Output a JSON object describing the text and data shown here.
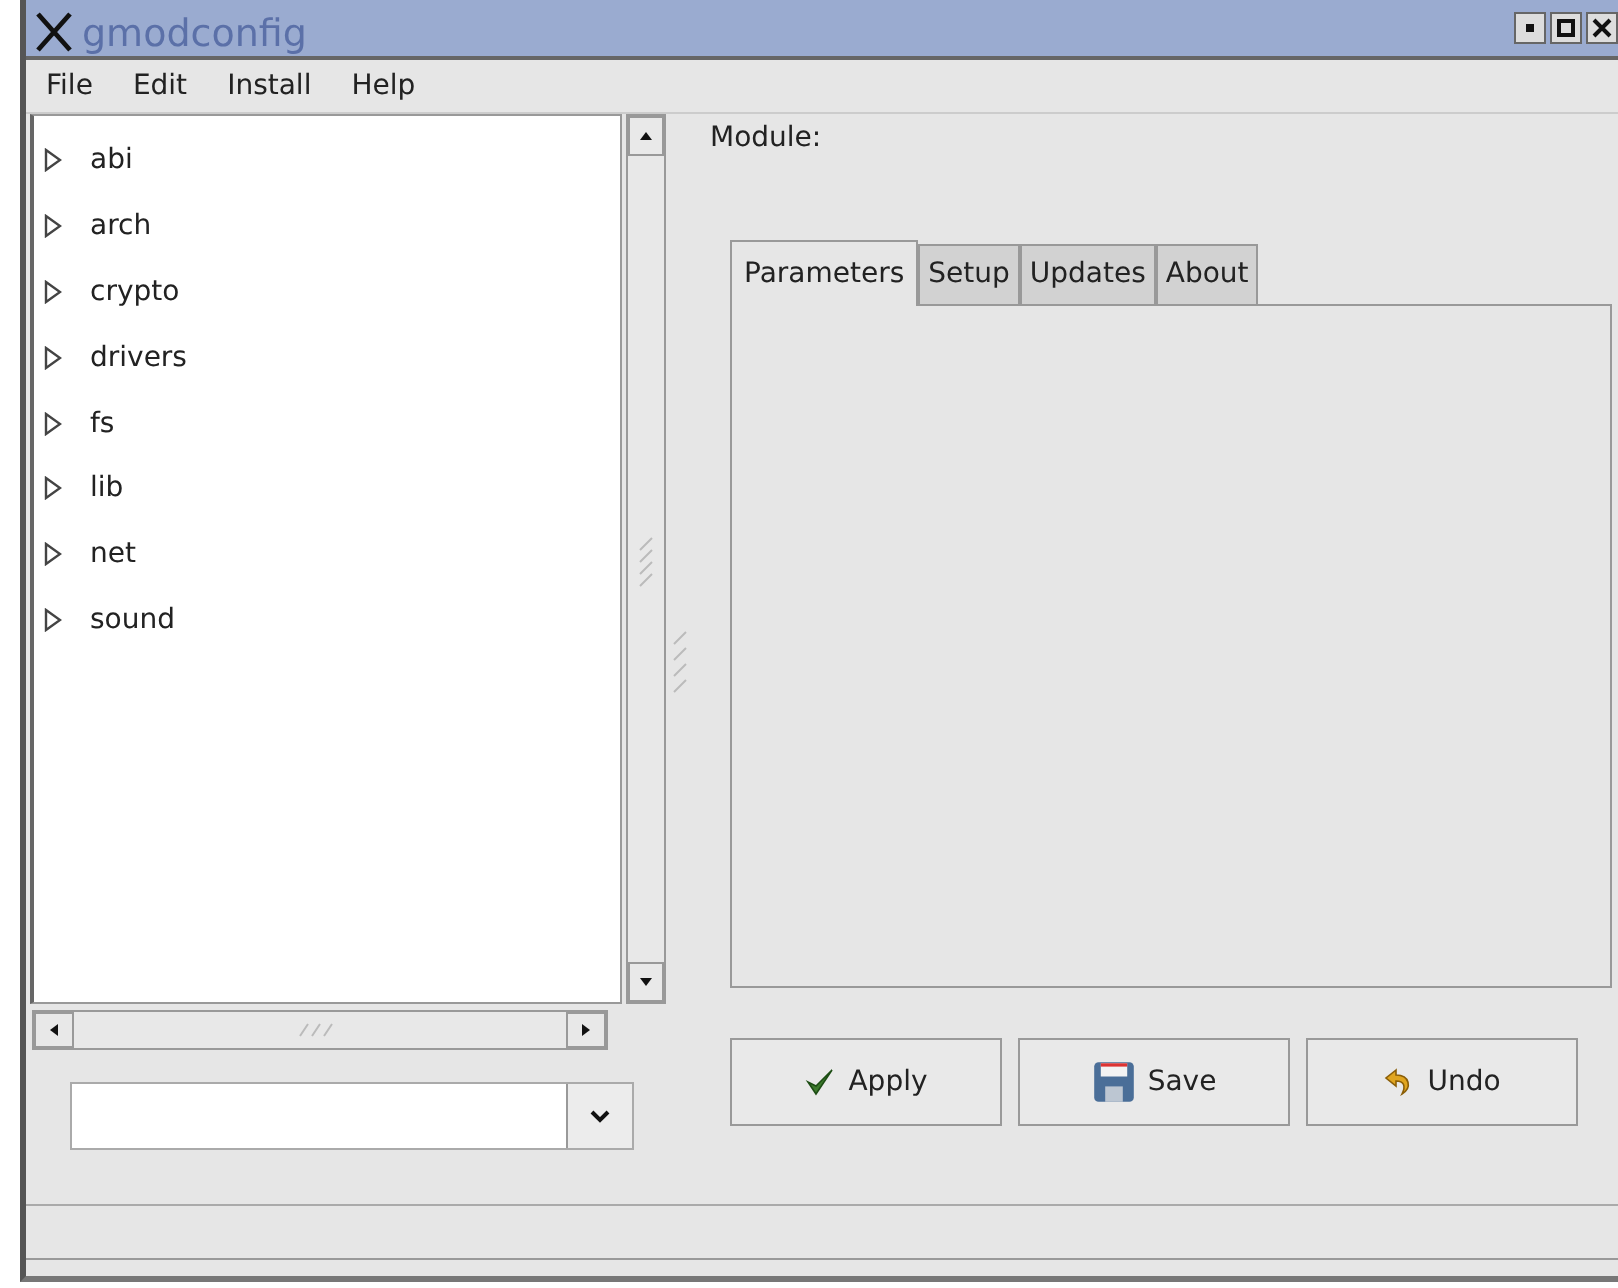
{
  "window": {
    "title": "gmodconfig"
  },
  "menu": [
    "File",
    "Edit",
    "Install",
    "Help"
  ],
  "tree": [
    {
      "label": "abi",
      "expanded": false
    },
    {
      "label": "arch",
      "expanded": false
    },
    {
      "label": "crypto",
      "expanded": false
    },
    {
      "label": "drivers",
      "expanded": false
    },
    {
      "label": "fs",
      "expanded": false
    },
    {
      "label": "lib",
      "expanded": false
    },
    {
      "label": "net",
      "expanded": false
    },
    {
      "label": "sound",
      "expanded": false
    }
  ],
  "module_label": "Module:",
  "tabs": [
    {
      "label": "Parameters",
      "selected": true
    },
    {
      "label": "Setup",
      "selected": false
    },
    {
      "label": "Updates",
      "selected": false
    },
    {
      "label": "About",
      "selected": false
    }
  ],
  "buttons": [
    {
      "label": "Apply",
      "kind": "apply"
    },
    {
      "label": "Save",
      "kind": "save"
    },
    {
      "label": "Undo",
      "kind": "undo"
    }
  ]
}
